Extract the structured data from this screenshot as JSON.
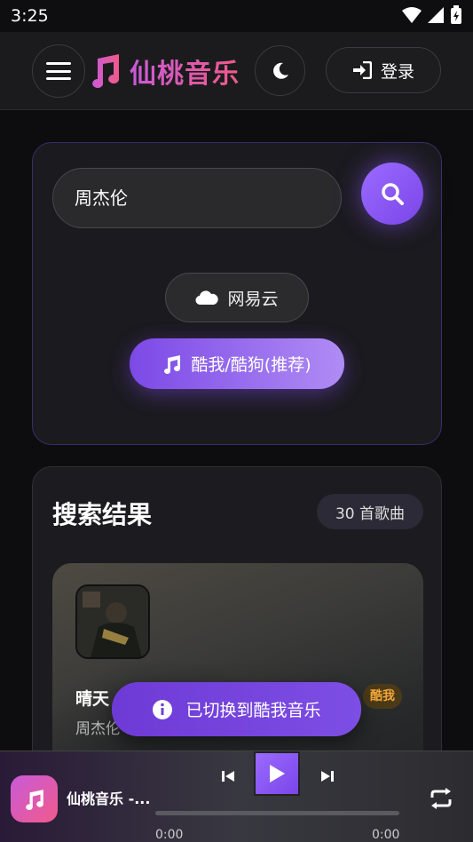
{
  "status_bar": {
    "time": "3:25"
  },
  "header": {
    "app_title": "仙桃音乐",
    "login_label": "登录"
  },
  "search": {
    "query": "周杰伦",
    "sources": [
      {
        "label": "网易云",
        "active": false
      },
      {
        "label": "酷我/酷狗(推荐)",
        "active": true
      }
    ]
  },
  "results": {
    "title": "搜索结果",
    "count": "30 首歌曲",
    "songs": [
      {
        "name": "晴天",
        "artist": "周杰伦",
        "source_tag": "酷我"
      }
    ]
  },
  "toast": {
    "message": "已切换到酷我音乐"
  },
  "player": {
    "title": "仙桃音乐 -...",
    "current_time": "0:00",
    "total_time": "0:00",
    "progress": 0
  },
  "colors": {
    "accent": "#7a45e8",
    "brand_gradient_start": "#c95ad9",
    "brand_gradient_end": "#f05a8a",
    "tag_color": "#f2a63a"
  }
}
